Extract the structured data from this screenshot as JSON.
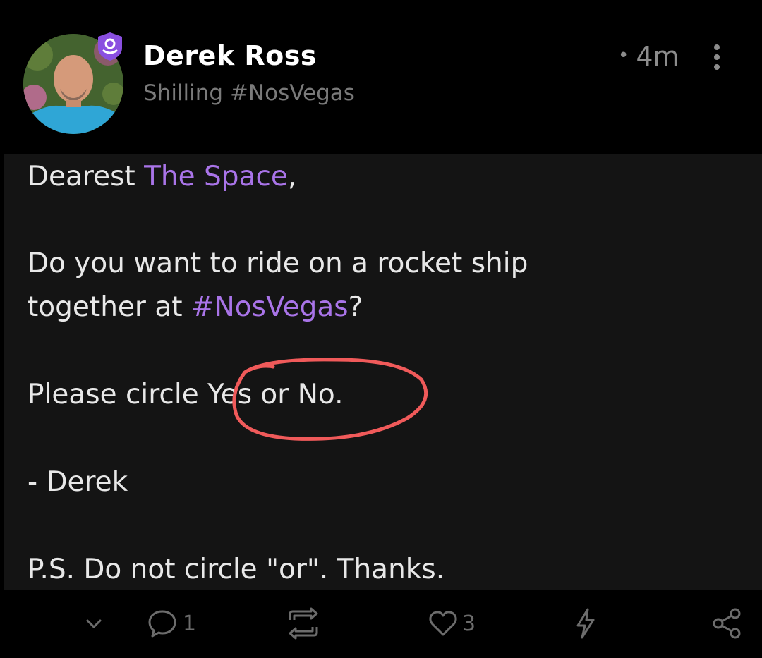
{
  "author": {
    "display_name": "Derek Ross",
    "subtitle": "Shilling #NosVegas",
    "avatar_icon": "avatar-photo",
    "verified_badge_icon": "verified-badge-icon"
  },
  "post_meta": {
    "dot": "•",
    "time": "4m"
  },
  "post": {
    "greeting_prefix": "Dearest ",
    "greeting_mention": "The Space",
    "greeting_suffix": ",",
    "line2": "Do you want to ride on a rocket ship",
    "line3_prefix": "together at ",
    "line3_hashtag": "#NosVegas",
    "line3_suffix": "?",
    "line4": "Please circle Yes or No.",
    "signature": "- Derek",
    "postscript": "P.S. Do not circle \"or\". Thanks."
  },
  "actions": {
    "reply_count": "1",
    "like_count": "3"
  },
  "colors": {
    "accent": "#a974e8",
    "circle_annotation": "#f05a5a",
    "background": "#000000",
    "content_background": "#141414"
  }
}
